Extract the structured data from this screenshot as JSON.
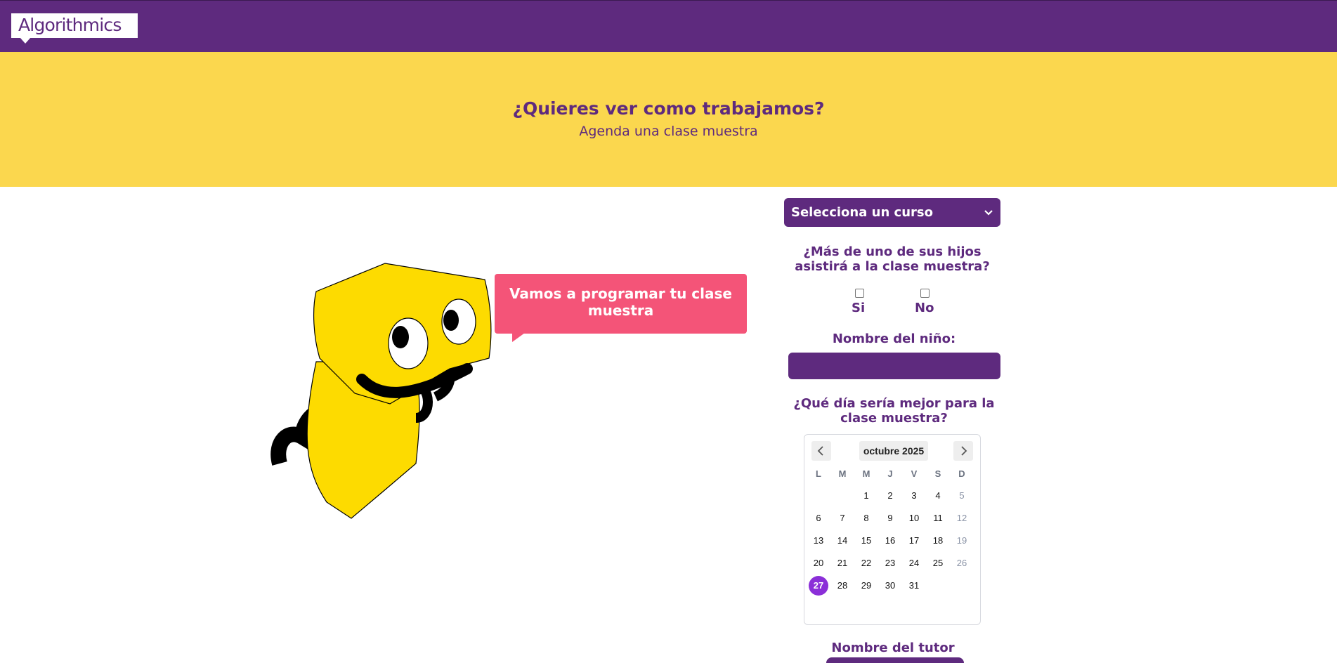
{
  "brand": {
    "logo_text": "Algorithmics"
  },
  "hero": {
    "title": "¿Quieres ver como trabajamos?",
    "subtitle": "Agenda una clase muestra"
  },
  "bubble": {
    "text": "Vamos a programar tu clase muestra"
  },
  "form": {
    "course_select": {
      "value": "Selecciona un curso",
      "icon": "chevron-down-icon"
    },
    "siblings_question": "¿Más de uno de sus hijos asistirá a la clase muestra?",
    "option_yes": "Si",
    "option_no": "No",
    "child_name_label": "Nombre del niño:",
    "child_name_value": "",
    "day_question": "¿Qué día sería mejor para la clase muestra?",
    "tutor_name_label": "Nombre del tutor"
  },
  "calendar": {
    "month_label": "octubre 2025",
    "weekdays": [
      "L",
      "M",
      "M",
      "J",
      "V",
      "S",
      "D"
    ],
    "days": [
      "1",
      "2",
      "3",
      "4",
      "5",
      "6",
      "7",
      "8",
      "9",
      "10",
      "11",
      "12",
      "13",
      "14",
      "15",
      "16",
      "17",
      "18",
      "19",
      "20",
      "21",
      "22",
      "23",
      "24",
      "25",
      "26",
      "27",
      "28",
      "29",
      "30",
      "31"
    ],
    "first_weekday_index": 2,
    "selected_day": "27",
    "prev_icon": "chevron-left-icon",
    "next_icon": "chevron-right-icon"
  },
  "colors": {
    "brand_purple": "#5e2a7e",
    "hero_yellow": "#fbd74e",
    "bubble_pink": "#f45478",
    "robot_yellow": "#fddb00",
    "selected_day": "#8b2fd8"
  }
}
